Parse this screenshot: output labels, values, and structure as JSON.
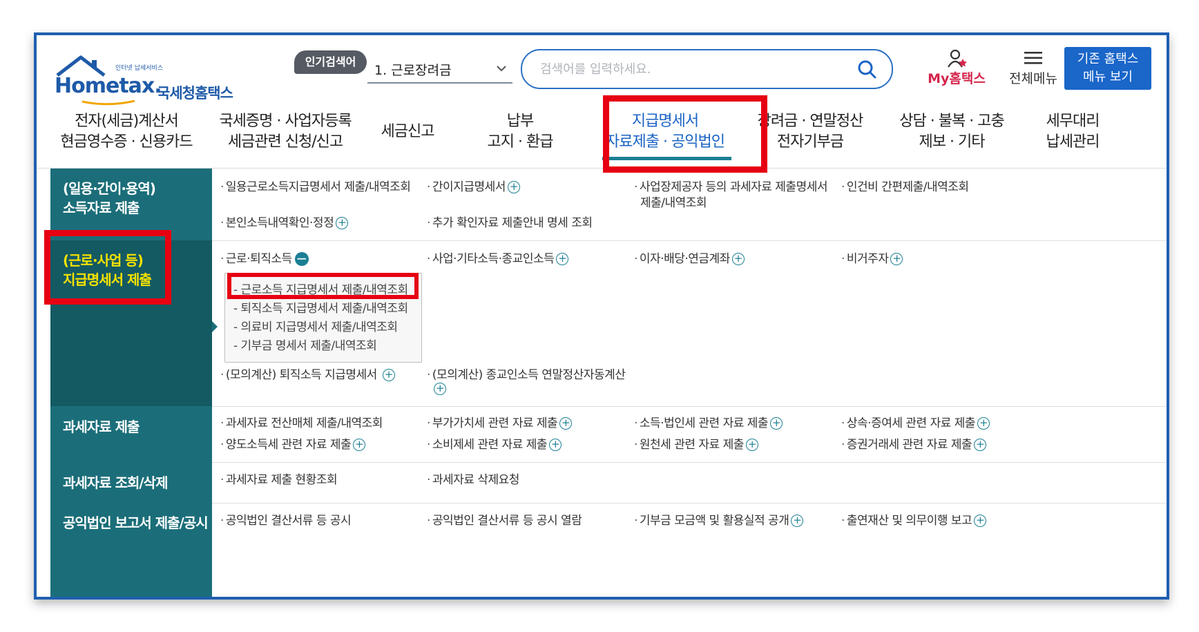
{
  "header": {
    "logo_tagline": "인터넷 납세서비스",
    "logo_brand": "Hometax.",
    "logo_name": "국세청홈택스",
    "popular_badge": "인기검색어",
    "popular_selected": "1.  근로장려금",
    "search_placeholder": "검색어를 입력하세요.",
    "my_home_label": "My홈택스",
    "all_menu_label": "전체메뉴",
    "old_menu_line1": "기존 홈택스",
    "old_menu_line2": "메뉴 보기"
  },
  "nav": [
    {
      "line1": "전자(세금)계산서",
      "line2": "현금영수증 · 신용카드"
    },
    {
      "line1": "국세증명 · 사업자등록",
      "line2": "세금관련 신청/신고"
    },
    {
      "line1": "세금신고",
      "line2": ""
    },
    {
      "line1": "납부",
      "line2": "고지 · 환급"
    },
    {
      "line1": "지급명세서",
      "line2": "자료제출 · 공익법인",
      "active": true
    },
    {
      "line1": "장려금 · 연말정산",
      "line2": "전자기부금"
    },
    {
      "line1": "상담 · 불복 · 고충",
      "line2": "제보 · 기타"
    },
    {
      "line1": "세무대리",
      "line2": "납세관리"
    }
  ],
  "sections": [
    {
      "title_line1": "(일용·간이·용역)",
      "title_line2": "소득자료 제출",
      "links": [
        "일용근로소득지급명세서 제출/내역조회",
        "간이지급명세서",
        "사업장제공자 등의 과세자료 제출명세서",
        "제출/내역조회",
        "인건비 간편제출/내역조회",
        "본인소득내역확인·정정",
        "추가 확인자료 제출안내 명세 조회"
      ]
    },
    {
      "title_line1": "(근로·사업 등)",
      "title_line2": "지급명세서 제출",
      "links": [
        "근로·퇴직소득",
        "사업·기타소득·종교인소득",
        "이자·배당·연금계좌",
        "비거주자",
        "(모의계산) 퇴직소득 지급명세서",
        "(모의계산) 종교인소득 연말정산자동계산"
      ],
      "submenu": [
        "근로소득 지급명세서 제출/내역조회",
        "퇴직소득 지급명세서 제출/내역조회",
        "의료비 지급명세서 제출/내역조회",
        "기부금 명세서 제출/내역조회"
      ]
    },
    {
      "title_line1": "과세자료 제출",
      "links": [
        "과세자료 전산매체 제출/내역조회",
        "부가가치세 관련 자료 제출",
        "소득·법인세 관련 자료 제출",
        "상속·증여세 관련 자료 제출",
        "양도소득세 관련 자료 제출",
        "소비제세 관련 자료 제출",
        "원천세 관련 자료 제출",
        "증권거래세 관련 자료 제출"
      ]
    },
    {
      "title_line1": "과세자료 조회/삭제",
      "links": [
        "과세자료 제출 현황조회",
        "과세자료 삭제요청"
      ]
    },
    {
      "title_line1": "공익법인 보고서 제출/공시",
      "links": [
        "공익법인 결산서류 등 공시",
        "공익법인 결산서류 등 공시 열람",
        "기부금 모금액 및 활용실적 공개",
        "출연재산 및 의무이행 보고"
      ]
    }
  ],
  "colors": {
    "sidebar": "#1b6e79",
    "highlight": "#e60012",
    "accent": "#1a63c4",
    "active_side_text": "#f7e300"
  }
}
